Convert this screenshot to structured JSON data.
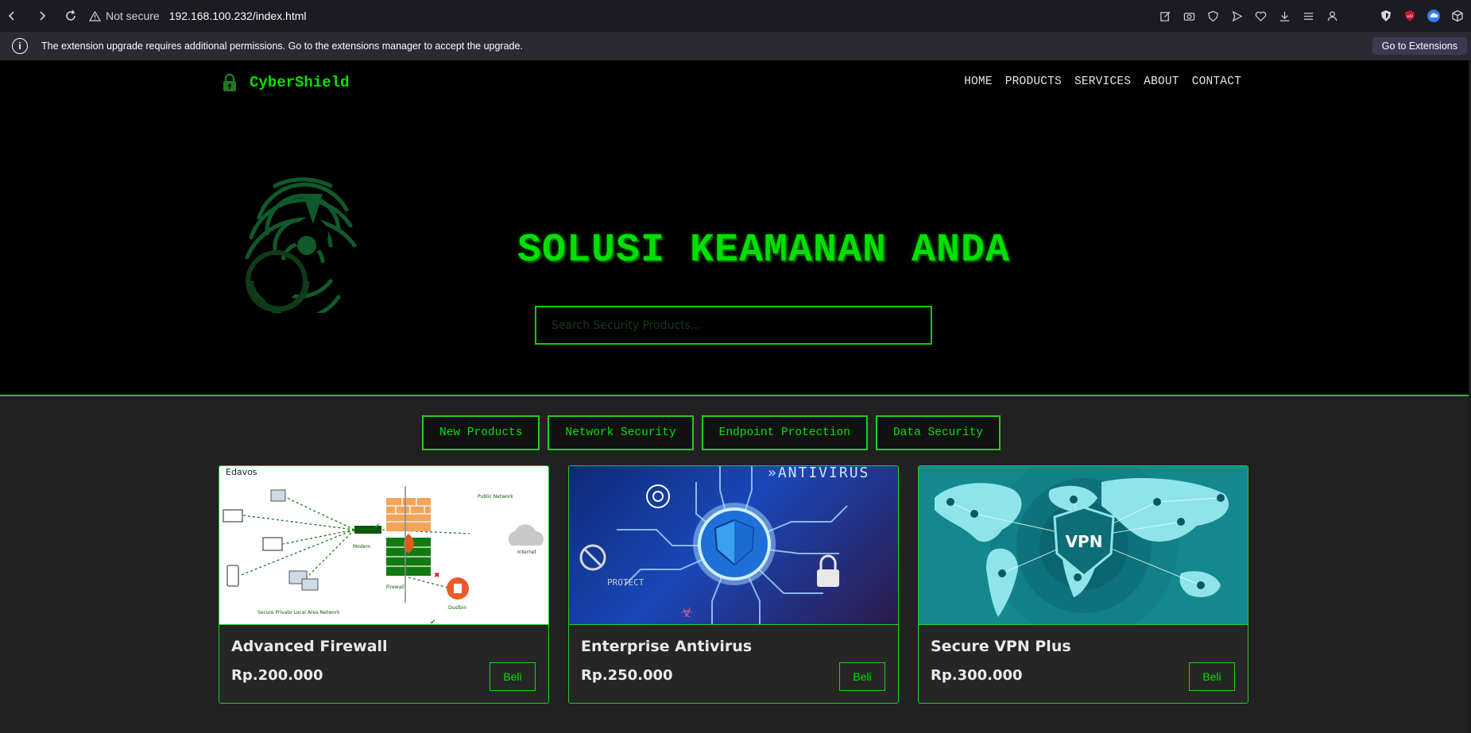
{
  "browser": {
    "security_label": "Not secure",
    "url": "192.168.100.232/index.html"
  },
  "notification": {
    "message": "The extension upgrade requires additional permissions. Go to the extensions manager to accept the upgrade.",
    "button": "Go to Extensions"
  },
  "site": {
    "brand": "CyberShield",
    "nav": [
      "HOME",
      "PRODUCTS",
      "SERVICES",
      "ABOUT",
      "CONTACT"
    ],
    "hero_title": "SOLUSI KEAMANAN ANDA",
    "search_placeholder": "Search Security Products..."
  },
  "filters": [
    "New Products",
    "Network Security",
    "Endpoint Protection",
    "Data Security"
  ],
  "products": [
    {
      "name": "Advanced Firewall",
      "price": "Rp.200.000",
      "buy": "Beli",
      "image_text": {
        "brand": "Edavos",
        "public": "Public Network",
        "modem": "Modem",
        "internet": "Internet",
        "firewall": "Firewall",
        "dustbin": "Dustbin",
        "lan": "Secure Private Local Area Network"
      }
    },
    {
      "name": "Enterprise Antivirus",
      "price": "Rp.250.000",
      "buy": "Beli",
      "image_text": {
        "banner": "»ANTIVIRUS",
        "protect": "PROTECT"
      }
    },
    {
      "name": "Secure VPN Plus",
      "price": "Rp.300.000",
      "buy": "Beli",
      "image_text": {
        "badge": "VPN"
      }
    }
  ],
  "colors": {
    "accent": "#00e000",
    "page_bg": "#000000",
    "section_bg": "#212121"
  }
}
